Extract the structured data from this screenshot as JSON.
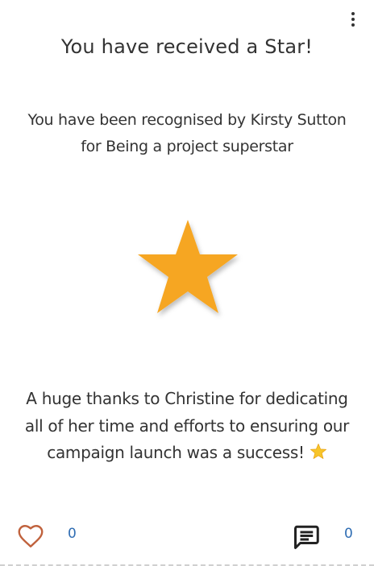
{
  "card": {
    "title": "You have received a Star!",
    "recognition_line1": "You have been recognised by Kirsty Sutton",
    "recognition_line2": "for Being a project superstar",
    "message_line1": "A huge thanks to Christine for dedicating",
    "message_line2": "all of her time and efforts to ensuring our",
    "message_line3": "campaign launch was a success!",
    "star_color": "#f6a623",
    "emoji_star_color": "#f7c52a"
  },
  "footer": {
    "like_count": "0",
    "comment_count": "0",
    "like_icon_color": "#c0623d",
    "count_color": "#2f6db3"
  },
  "icons": {
    "menu": "more-vertical-icon",
    "star": "star-icon",
    "like": "heart-icon",
    "comment": "comment-icon"
  }
}
